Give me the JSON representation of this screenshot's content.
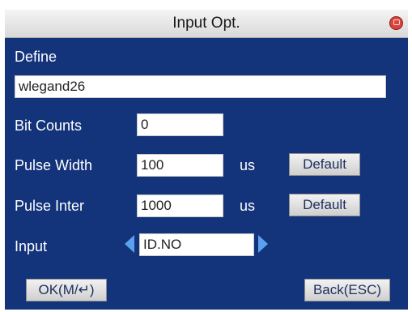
{
  "window": {
    "title": "Input Opt."
  },
  "define": {
    "label": "Define",
    "value": "wlegand26"
  },
  "bit_counts": {
    "label": "Bit Counts",
    "value": "0"
  },
  "pulse_width": {
    "label": "Pulse Width",
    "value": "100",
    "unit": "us",
    "default_label": "Default"
  },
  "pulse_inter": {
    "label": "Pulse Inter",
    "value": "1000",
    "unit": "us",
    "default_label": "Default"
  },
  "input": {
    "label": "Input",
    "value": "ID.NO"
  },
  "footer": {
    "ok_label": "OK(M/↵)",
    "back_label": "Back(ESC)"
  },
  "colors": {
    "panel": "#13337a",
    "accent_arrow": "#5aa2f0",
    "close": "#d9453c"
  }
}
